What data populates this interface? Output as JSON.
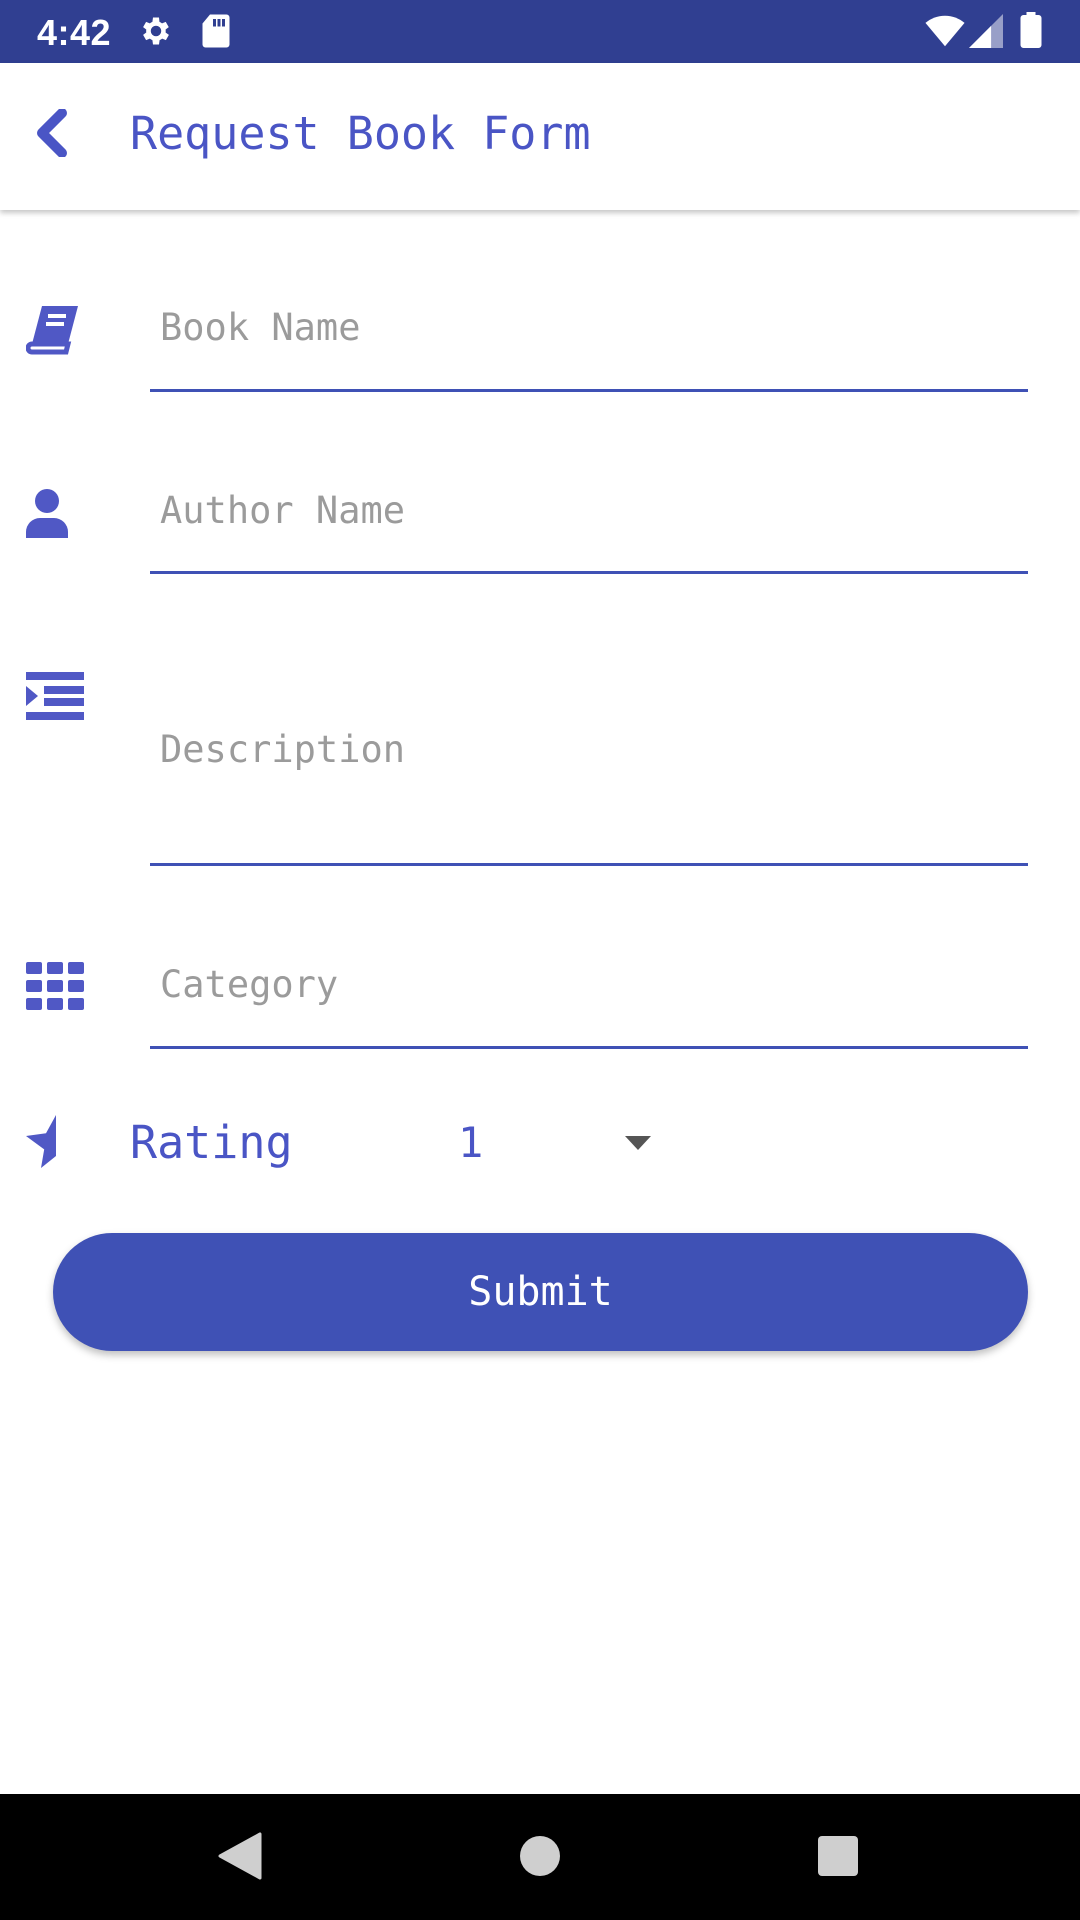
{
  "status_bar": {
    "time": "4:42",
    "icons": [
      "gear-icon",
      "sd-card-icon",
      "wifi-icon",
      "cellular-signal-icon",
      "battery-icon"
    ]
  },
  "app_bar": {
    "title": "Request Book Form",
    "back_icon": "chevron-left-icon"
  },
  "form": {
    "book_name": {
      "placeholder": "Book Name",
      "value": "",
      "icon": "book-icon"
    },
    "author_name": {
      "placeholder": "Author Name",
      "value": "",
      "icon": "user-icon"
    },
    "description": {
      "placeholder": "Description",
      "value": "",
      "icon": "indent-list-icon"
    },
    "category": {
      "placeholder": "Category",
      "value": "",
      "icon": "grid-icon"
    },
    "rating": {
      "label": "Rating",
      "selected": "1",
      "icon": "half-star-icon"
    },
    "submit_label": "Submit"
  },
  "colors": {
    "status_bar": "#303F91",
    "accent": "#3F51B5",
    "accent_text": "#4A55C5",
    "placeholder": "#9B9B9B",
    "nav_bar": "#000000"
  },
  "nav_bar": {
    "icons": [
      "back-triangle-icon",
      "home-circle-icon",
      "recents-square-icon"
    ]
  }
}
